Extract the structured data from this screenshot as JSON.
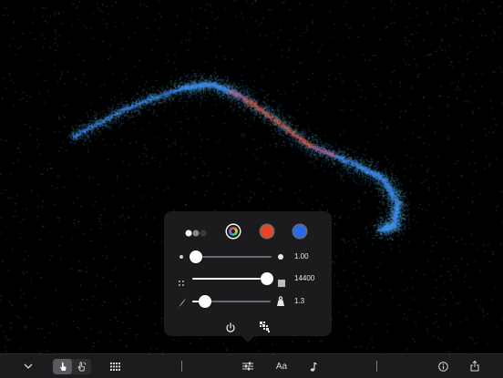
{
  "canvas": {
    "description_colors": {
      "blue": "#3a8ae0",
      "red": "#e0442a"
    }
  },
  "popover": {
    "swatches": [
      {
        "name": "rainbow",
        "color": "multicolor"
      },
      {
        "name": "red",
        "color": "#e8442a"
      },
      {
        "name": "blue",
        "color": "#2a6ae8"
      }
    ],
    "sliders": [
      {
        "name": "size",
        "value_text": "1.00",
        "level": 0.06
      },
      {
        "name": "count",
        "value_text": "14400",
        "level": 1.0
      },
      {
        "name": "speed",
        "value_text": "1.3",
        "level": 0.15
      }
    ]
  },
  "toolbar": {
    "items": [
      "chevron-down-icon",
      "hand-tap-icon",
      "hand-drag-icon",
      "grid-icon",
      "sliders-icon",
      "text-icon",
      "music-icon",
      "info-icon",
      "share-icon"
    ],
    "text_label": "Aa"
  },
  "colors": {
    "accent": "#ffffff",
    "background": "#000000",
    "popover": "#1b1b1d"
  }
}
